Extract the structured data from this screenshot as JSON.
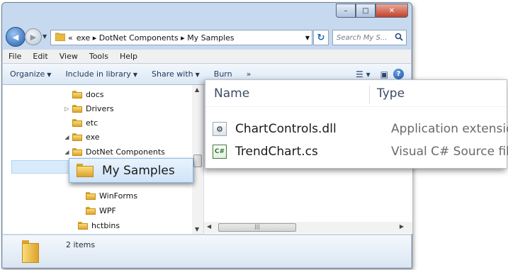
{
  "window": {
    "caption_buttons": {
      "minimize": "–",
      "maximize": "□",
      "close": "✕"
    }
  },
  "address": {
    "back_icon": "back-arrow-icon",
    "forward_icon": "forward-arrow-icon",
    "prefix": "«",
    "crumbs": "exe ▸ DotNet Components ▸ My Samples",
    "refresh_icon": "refresh-icon",
    "search_placeholder": "Search My S...",
    "search_icon": "magnifier-icon"
  },
  "menu": {
    "items": [
      "File",
      "Edit",
      "View",
      "Tools",
      "Help"
    ]
  },
  "toolbar": {
    "organize": "Organize",
    "include": "Include in library",
    "share": "Share with",
    "burn": "Burn",
    "more": "»",
    "views_icon": "views-icon",
    "preview_icon": "preview-pane-icon",
    "help_icon": "help-icon",
    "help_glyph": "?"
  },
  "tree": {
    "items": [
      {
        "label": "docs",
        "expander": ""
      },
      {
        "label": "Drivers",
        "expander": "▷"
      },
      {
        "label": "etc",
        "expander": ""
      },
      {
        "label": "exe",
        "expander": "◢"
      },
      {
        "label": "DotNet Components",
        "expander": "◢"
      },
      {
        "label": "My Samples",
        "expander": ""
      },
      {
        "label": "WinForms",
        "expander": ""
      },
      {
        "label": "WPF",
        "expander": ""
      },
      {
        "label": "hctbins",
        "expander": ""
      }
    ]
  },
  "file_list": {
    "columns": [
      "Name",
      "Type"
    ],
    "rows": [
      {
        "name": "ChartControls.dll",
        "type": "Application extension",
        "icon": "dll-file-icon"
      },
      {
        "name": "TrendChart.cs",
        "type": "Visual C# Source file",
        "icon": "csharp-file-icon"
      }
    ]
  },
  "details": {
    "count": "2 items"
  },
  "colors": {
    "selection": "#cfe4f9",
    "folder": "#f0c24a",
    "toolbar": "#dbe7f5"
  }
}
